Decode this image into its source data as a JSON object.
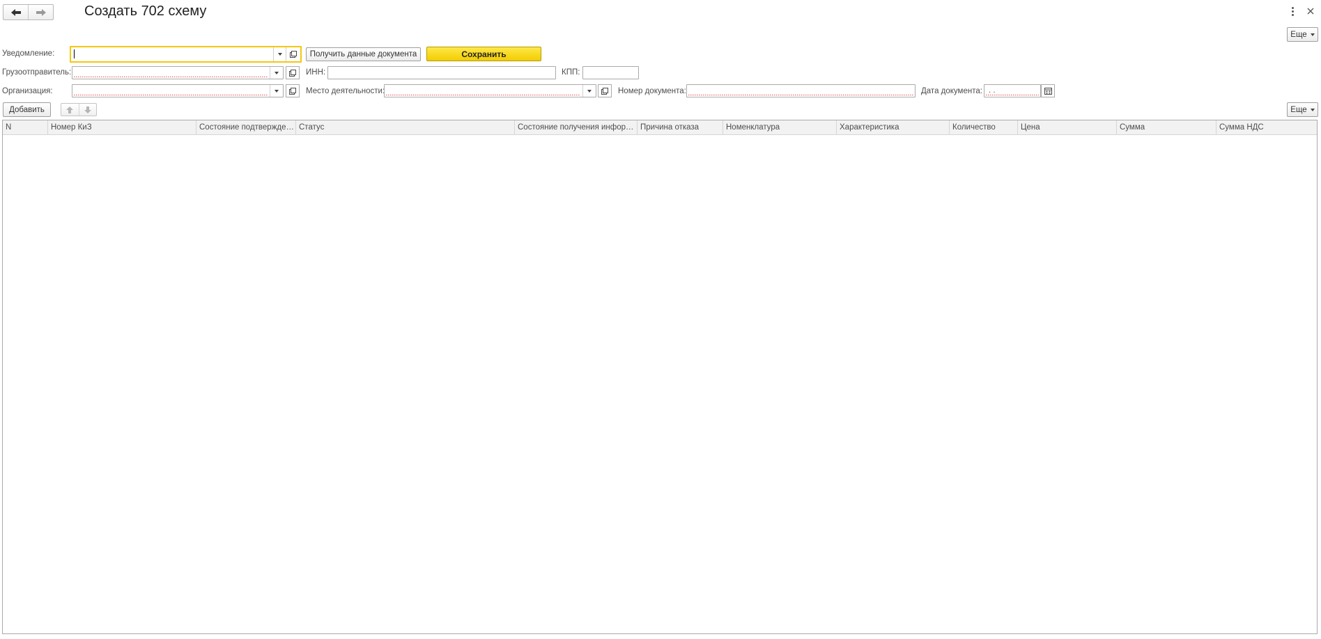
{
  "window": {
    "title": "Создать 702 схему"
  },
  "toolbar": {
    "more_label": "Еще"
  },
  "form": {
    "notification_label": "Уведомление:",
    "notification_value": "",
    "get_data_button": "Получить данные документа",
    "save_button": "Сохранить",
    "shipper_label": "Грузоотправитель:",
    "shipper_value": "",
    "inn_label": "ИНН:",
    "inn_value": "",
    "kpp_label": "КПП:",
    "kpp_value": "",
    "organization_label": "Организация:",
    "organization_value": "",
    "place_label": "Место деятельности:",
    "place_value": "",
    "doc_number_label": "Номер документа:",
    "doc_number_value": "",
    "doc_date_label": "Дата документа:",
    "doc_date_value": " .  . "
  },
  "table_toolbar": {
    "add_button": "Добавить",
    "more_label": "Еще"
  },
  "table": {
    "columns": [
      "N",
      "Номер КиЗ",
      "Состояние подтвержден...",
      "Статус",
      "Состояние получения информа...",
      "Причина отказа",
      "Номенклатура",
      "Характеристика",
      "Количество",
      "Цена",
      "Сумма",
      "Сумма НДС"
    ],
    "rows": []
  },
  "icons": {
    "back": "arrow-left-icon",
    "forward": "arrow-right-icon",
    "kebab": "kebab-menu-icon",
    "close": "close-icon",
    "dropdown": "chevron-down-icon",
    "open": "open-link-icon",
    "calendar": "calendar-icon",
    "move_up": "arrow-up-icon",
    "move_down": "arrow-down-icon"
  }
}
